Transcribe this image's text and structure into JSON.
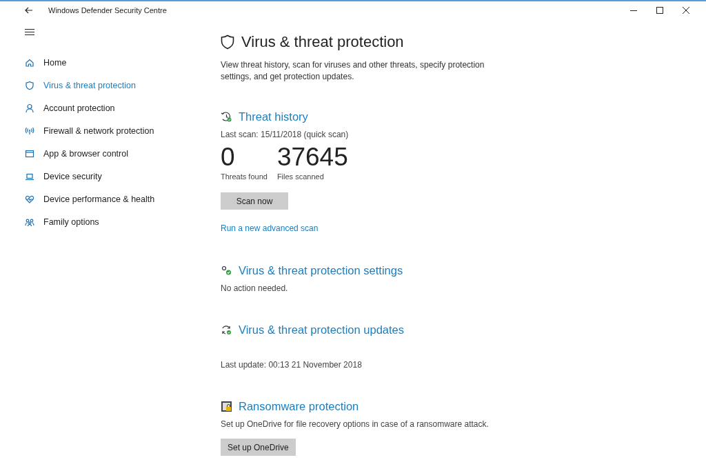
{
  "window": {
    "title": "Windows Defender Security Centre"
  },
  "sidebar": {
    "items": [
      {
        "kind": "home",
        "label": "Home",
        "selected": false
      },
      {
        "kind": "shield",
        "label": "Virus & threat protection",
        "selected": true
      },
      {
        "kind": "person",
        "label": "Account protection",
        "selected": false
      },
      {
        "kind": "antenna",
        "label": "Firewall & network protection",
        "selected": false
      },
      {
        "kind": "window",
        "label": "App & browser control",
        "selected": false
      },
      {
        "kind": "laptop",
        "label": "Device security",
        "selected": false
      },
      {
        "kind": "heart",
        "label": "Device performance & health",
        "selected": false
      },
      {
        "kind": "family",
        "label": "Family options",
        "selected": false
      }
    ]
  },
  "page": {
    "title": "Virus & threat protection",
    "description": "View threat history, scan for viruses and other threats, specify protection settings, and get protection updates."
  },
  "sections": [
    {
      "kind": "history",
      "heading": "Threat history",
      "text": "Last scan: 15/11/2018 (quick scan)",
      "stats": [
        {
          "value": "0",
          "label": "Threats found"
        },
        {
          "value": "37645",
          "label": "Files scanned"
        }
      ],
      "button": "Scan now",
      "link": "Run a new advanced scan"
    },
    {
      "kind": "settings",
      "heading": "Virus & threat protection settings",
      "text": "No action needed."
    },
    {
      "kind": "updates",
      "heading": "Virus & threat protection updates",
      "text": "Last update: 00:13 21 November 2018"
    },
    {
      "kind": "ransomware",
      "heading": "Ransomware protection",
      "text": "Set up OneDrive for file recovery options in case of a ransomware attack.",
      "button": "Set up OneDrive"
    }
  ]
}
